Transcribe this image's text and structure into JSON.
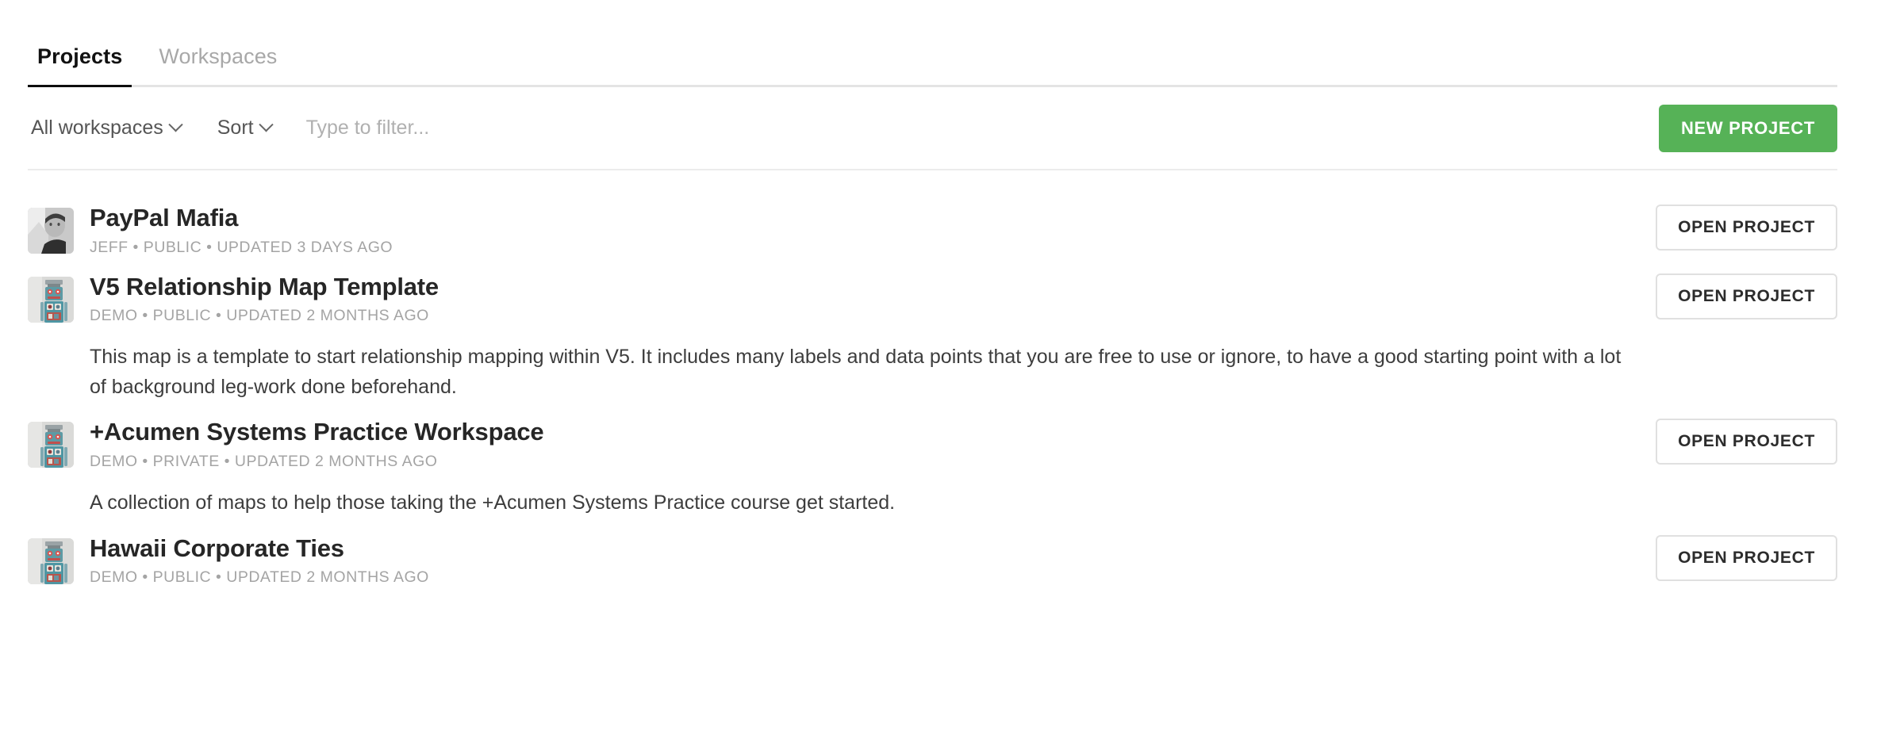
{
  "tabs": [
    {
      "label": "Projects",
      "active": true
    },
    {
      "label": "Workspaces",
      "active": false
    }
  ],
  "filter_bar": {
    "workspace_filter_label": "All workspaces",
    "sort_label": "Sort",
    "filter_placeholder": "Type to filter...",
    "new_project_label": "NEW PROJECT"
  },
  "colors": {
    "accent_green": "#56b257",
    "active_tab_underline": "#0d0d0d",
    "meta_text": "#a4a4a4",
    "border": "#e0e0e0"
  },
  "open_project_label": "OPEN PROJECT",
  "projects": [
    {
      "title": "PayPal Mafia",
      "owner": "JEFF",
      "visibility": "PUBLIC",
      "updated": "UPDATED 3 DAYS AGO",
      "meta": "JEFF • PUBLIC • UPDATED 3 DAYS AGO",
      "description": "",
      "thumbnail": "avatar-photo",
      "action_label": "OPEN PROJECT"
    },
    {
      "title": "V5 Relationship Map Template",
      "owner": "DEMO",
      "visibility": "PUBLIC",
      "updated": "UPDATED 2 MONTHS AGO",
      "meta": "DEMO • PUBLIC • UPDATED 2 MONTHS AGO",
      "description": "This map is a template to start relationship mapping within V5. It includes many labels and data points that you are free to use or ignore, to have a good starting point with a lot of background leg-work done beforehand.",
      "thumbnail": "robot-photo",
      "action_label": "OPEN PROJECT"
    },
    {
      "title": "+Acumen Systems Practice Workspace",
      "owner": "DEMO",
      "visibility": "PRIVATE",
      "updated": "UPDATED 2 MONTHS AGO",
      "meta": "DEMO • PRIVATE • UPDATED 2 MONTHS AGO",
      "description": "A collection of maps to help those taking the +Acumen Systems Practice course get started.",
      "thumbnail": "robot-photo",
      "action_label": "OPEN PROJECT"
    },
    {
      "title": "Hawaii Corporate Ties",
      "owner": "DEMO",
      "visibility": "PUBLIC",
      "updated": "UPDATED 2 MONTHS AGO",
      "meta": "DEMO • PUBLIC • UPDATED 2 MONTHS AGO",
      "description": "",
      "thumbnail": "robot-photo",
      "action_label": "OPEN PROJECT"
    }
  ]
}
